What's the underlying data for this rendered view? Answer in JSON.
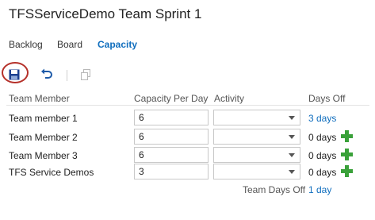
{
  "page": {
    "title": "TFSServiceDemo Team Sprint 1"
  },
  "tabs": [
    {
      "label": "Backlog",
      "active": false
    },
    {
      "label": "Board",
      "active": false
    },
    {
      "label": "Capacity",
      "active": true
    }
  ],
  "toolbar": {
    "save_icon": "save-icon",
    "undo_icon": "undo-icon",
    "copy_icon": "copy-icon",
    "highlight_color": "#b5312a"
  },
  "grid": {
    "headers": {
      "member": "Team Member",
      "capacity": "Capacity Per Day",
      "activity": "Activity",
      "days_off": "Days Off"
    },
    "rows": [
      {
        "member": "Team member 1",
        "capacity": "6",
        "activity": "",
        "days_off": "3 days",
        "days_off_link": true,
        "has_add": false
      },
      {
        "member": "Team Member 2",
        "capacity": "6",
        "activity": "",
        "days_off": "0 days",
        "days_off_link": false,
        "has_add": true
      },
      {
        "member": "Team Member 3",
        "capacity": "6",
        "activity": "",
        "days_off": "0 days",
        "days_off_link": false,
        "has_add": true
      },
      {
        "member": "TFS Service Demos",
        "capacity": "3",
        "activity": "",
        "days_off": "0 days",
        "days_off_link": false,
        "has_add": true
      }
    ]
  },
  "footer": {
    "team_days_off_label": "Team Days Off",
    "team_days_off_value": "1 day"
  },
  "colors": {
    "link": "#106ebe",
    "add": "#3aa13a",
    "active_tab": "#106ebe"
  }
}
